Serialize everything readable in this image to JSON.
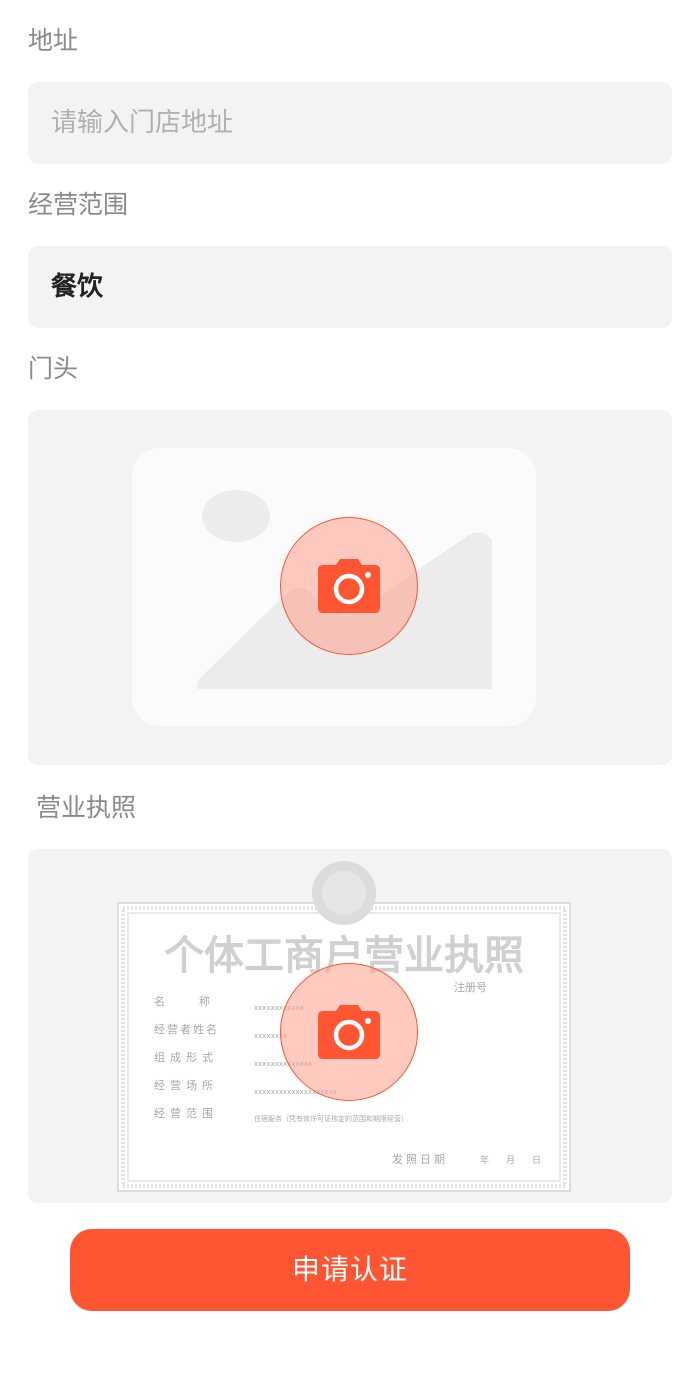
{
  "address": {
    "label": "地址",
    "placeholder": "请输入门店地址",
    "value": ""
  },
  "scope": {
    "label": "经营范围",
    "value": "餐饮"
  },
  "storefront": {
    "label": "门头"
  },
  "license": {
    "label": "营业执照",
    "sample": {
      "title": "个体工商户营业执照",
      "reg_no_label": "注册号",
      "rows": [
        {
          "label": "名　　称",
          "value": "xxxxxxxxxxxx"
        },
        {
          "label": "经营者姓名",
          "value": "xxxxxxxx"
        },
        {
          "label": "组成形式",
          "value": "xxxxxxxxxxxxxx"
        },
        {
          "label": "经营场所",
          "value": "xxxxxxxxxxxxxxxxxxxx"
        },
        {
          "label": "经营范围",
          "value": "住宿服务（凭有效许可证核定的范围和期限经营）"
        }
      ],
      "issue_label": "发照日期",
      "date_units": [
        "年",
        "月",
        "日"
      ]
    }
  },
  "submit_label": "申请认证",
  "colors": {
    "accent": "#ff5533",
    "field_bg": "#f3f3f3",
    "label_text": "#8a8a8a"
  },
  "icons": {
    "camera": "camera-icon",
    "placeholder_image": "image-placeholder-icon"
  }
}
